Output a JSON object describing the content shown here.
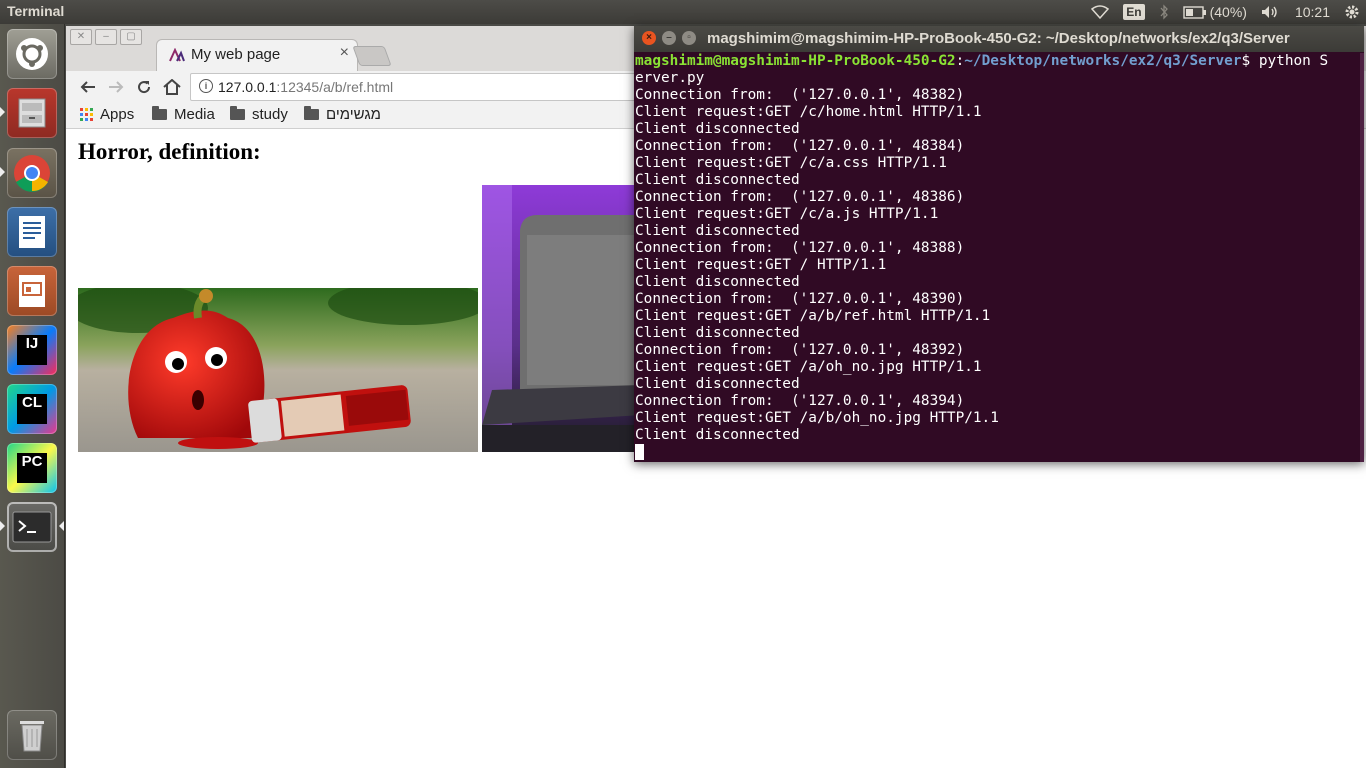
{
  "top_panel": {
    "title": "Terminal",
    "lang": "En",
    "battery": "(40%)",
    "time": "10:21"
  },
  "launcher": {
    "items": [
      "ubuntu-dash",
      "files",
      "chrome",
      "libreoffice-writer",
      "libreoffice-impress",
      "intellij-idea",
      "clion",
      "pycharm",
      "terminal",
      "trash"
    ],
    "ij_label": "IJ",
    "cl_label": "CL",
    "pc_label": "PC"
  },
  "browser": {
    "tab_title": "My web page",
    "url_host": "127.0.0.1",
    "url_rest": ":12345/a/b/ref.html",
    "bookmarks": [
      "Apps",
      "Media",
      "study",
      "מגשימים"
    ],
    "heading": "Horror, definition:"
  },
  "terminal": {
    "title": "magshimim@magshimim-HP-ProBook-450-G2: ~/Desktop/networks/ex2/q3/Server",
    "prompt_user": "magshimim@magshimim-HP-ProBook-450-G2",
    "prompt_path": "~/Desktop/networks/ex2/q3/Server",
    "command_part1": "$ python S",
    "command_part2": "erver.py",
    "lines": [
      "Connection from:  ('127.0.0.1', 48382)",
      "Client request:GET /c/home.html HTTP/1.1",
      "Client disconnected",
      "Connection from:  ('127.0.0.1', 48384)",
      "Client request:GET /c/a.css HTTP/1.1",
      "Client disconnected",
      "Connection from:  ('127.0.0.1', 48386)",
      "Client request:GET /c/a.js HTTP/1.1",
      "Client disconnected",
      "Connection from:  ('127.0.0.1', 48388)",
      "Client request:GET / HTTP/1.1",
      "Client disconnected",
      "Connection from:  ('127.0.0.1', 48390)",
      "Client request:GET /a/b/ref.html HTTP/1.1",
      "Client disconnected",
      "Connection from:  ('127.0.0.1', 48392)",
      "Client request:GET /a/oh_no.jpg HTTP/1.1",
      "Client disconnected",
      "Connection from:  ('127.0.0.1', 48394)",
      "Client request:GET /a/b/oh_no.jpg HTTP/1.1",
      "Client disconnected"
    ]
  },
  "colors": {
    "terminal_bg": "#300a24",
    "prompt_user": "#8ae234",
    "prompt_path": "#729fcf",
    "close_button": "#e95420"
  }
}
